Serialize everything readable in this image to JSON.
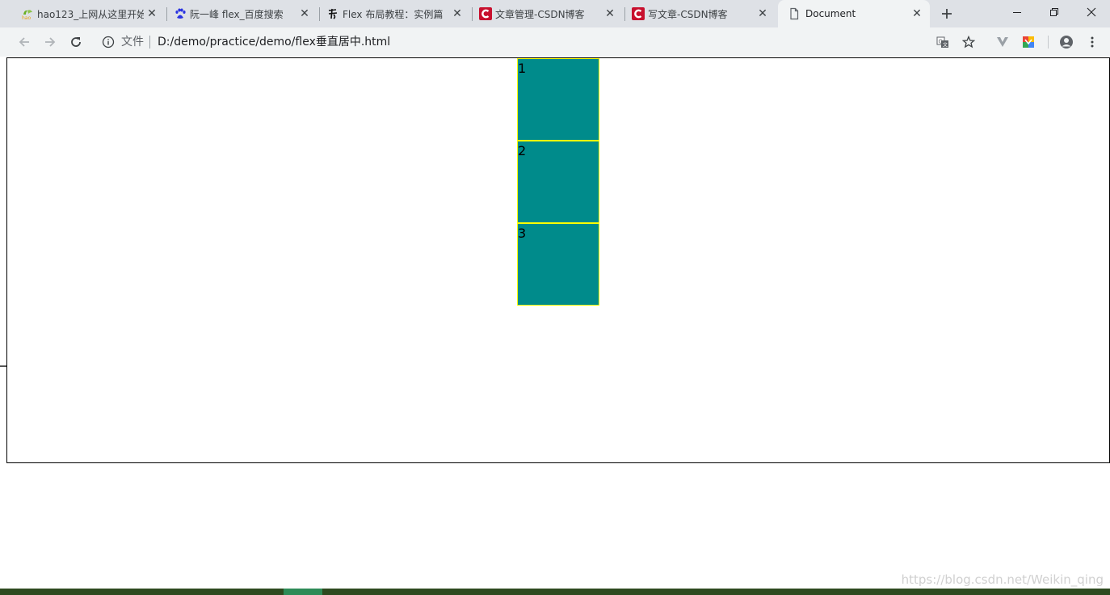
{
  "tabs": [
    {
      "label": "hao123_上网从这里开始",
      "icon": "hao123-icon",
      "active": false
    },
    {
      "label": "阮一峰 flex_百度搜索",
      "icon": "baidu-paw-icon",
      "active": false
    },
    {
      "label": "Flex 布局教程：实例篇",
      "icon": "calligraphy-icon",
      "active": false
    },
    {
      "label": "文章管理-CSDN博客",
      "icon": "csdn-icon",
      "active": false
    },
    {
      "label": "写文章-CSDN博客",
      "icon": "csdn-icon",
      "active": false
    },
    {
      "label": "Document",
      "icon": "document-icon",
      "active": true
    }
  ],
  "omnibox": {
    "chip": "文件",
    "url": "D:/demo/practice/demo/flex垂直居中.html"
  },
  "toolbar_icons": [
    "back-icon",
    "forward-icon",
    "reload-icon",
    "info-icon",
    "translate-icon",
    "star-icon",
    "extension-v-icon",
    "extension-color-icon",
    "account-icon",
    "menu-icon"
  ],
  "page": {
    "boxes": [
      "1",
      "2",
      "3"
    ]
  },
  "colors": {
    "box_fill": "#008b8b",
    "box_border": "#ffff00",
    "container_border": "#000000",
    "csdn_red": "#c8102e",
    "taskbar": "#2e4a1f"
  },
  "watermark": "https://blog.csdn.net/Weikin_qing"
}
